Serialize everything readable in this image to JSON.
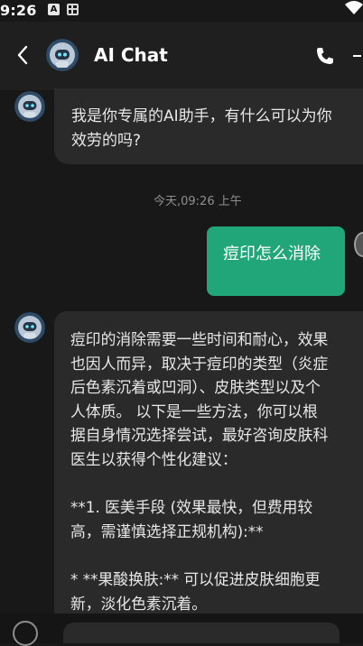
{
  "status_bar": {
    "time": "9:26",
    "notification_icon_label": "A",
    "icons": [
      "notification-a-icon",
      "grid-app-icon",
      "wifi-icon"
    ]
  },
  "app_bar": {
    "title": "AI Chat",
    "icons": [
      "back-arrow-icon",
      "robot-avatar-icon",
      "phone-icon",
      "more-icon"
    ]
  },
  "messages": [
    {
      "sender": "ai",
      "text": "我是你专属的AI助手，有什么可以为你\n效劳的吗?"
    },
    {
      "sender": "user",
      "text": "痘印怎么消除"
    },
    {
      "sender": "ai",
      "text": "痘印的消除需要一些时间和耐心，效果\n也因人而异，取决于痘印的类型（炎症\n后色素沉着或凹洞）、皮肤类型以及个\n人体质。 以下是一些方法，你可以根\n据自身情况选择尝试，最好咨询皮肤科\n医生以获得个性化建议：\n\n**1. 医美手段 (效果最快，但费用较\n高，需谨慎选择正规机构):**\n\n* **果酸换肤:** 可以促进皮肤细胞更\n新，淡化色素沉着。"
    }
  ],
  "timestamp": "今天,09:26 上午",
  "colors": {
    "background": "#181818",
    "app_bar": "#1f1f1f",
    "ai_bubble": "#2a2a2a",
    "user_bubble": "#21a67a",
    "timestamp": "#8f8f8f"
  }
}
